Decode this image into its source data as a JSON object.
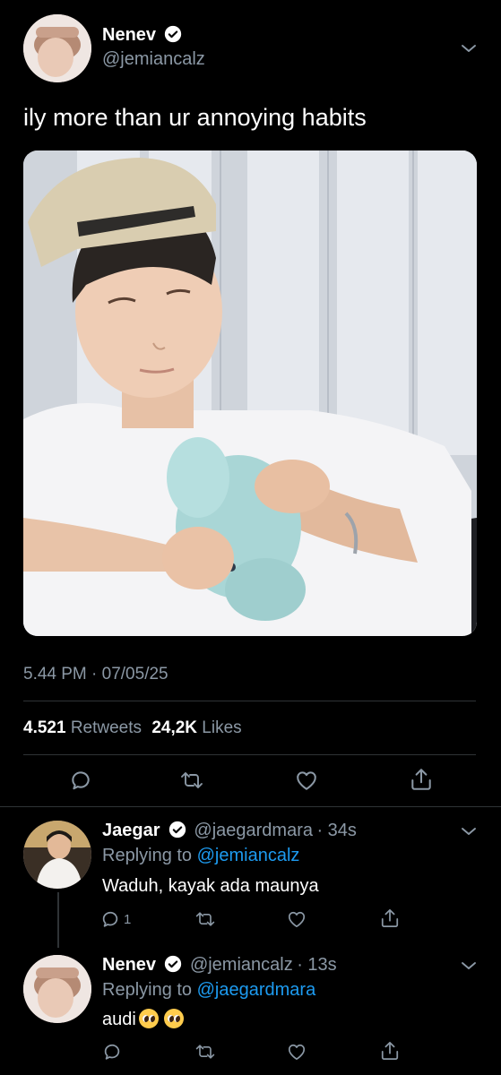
{
  "tweet": {
    "author_name": "Nenev",
    "author_handle": "@jemiancalz",
    "text": "ily more than ur annoying habits",
    "timestamp": "5.44 PM · 07/05/25",
    "retweets_count": "4.521",
    "retweets_label": "Retweets",
    "likes_count": "24,2K",
    "likes_label": "Likes"
  },
  "replies": [
    {
      "name": "Jaegar",
      "handle": "@jaegardmara",
      "time": "· 34s",
      "replying_prefix": "Replying to",
      "replying_to": "@jemiancalz",
      "text": "Waduh, kayak ada maunya",
      "reply_count": "1"
    },
    {
      "name": "Nenev",
      "handle": "@jemiancalz",
      "time": "· 13s",
      "replying_prefix": "Replying to",
      "replying_to": "@jaegardmara",
      "text": "audi",
      "emojis": [
        "pleading-face",
        "pleading-face"
      ]
    }
  ],
  "colors": {
    "background": "#000000",
    "muted": "#8b98a5",
    "link": "#1d9bf0",
    "divider": "#2f3336"
  }
}
